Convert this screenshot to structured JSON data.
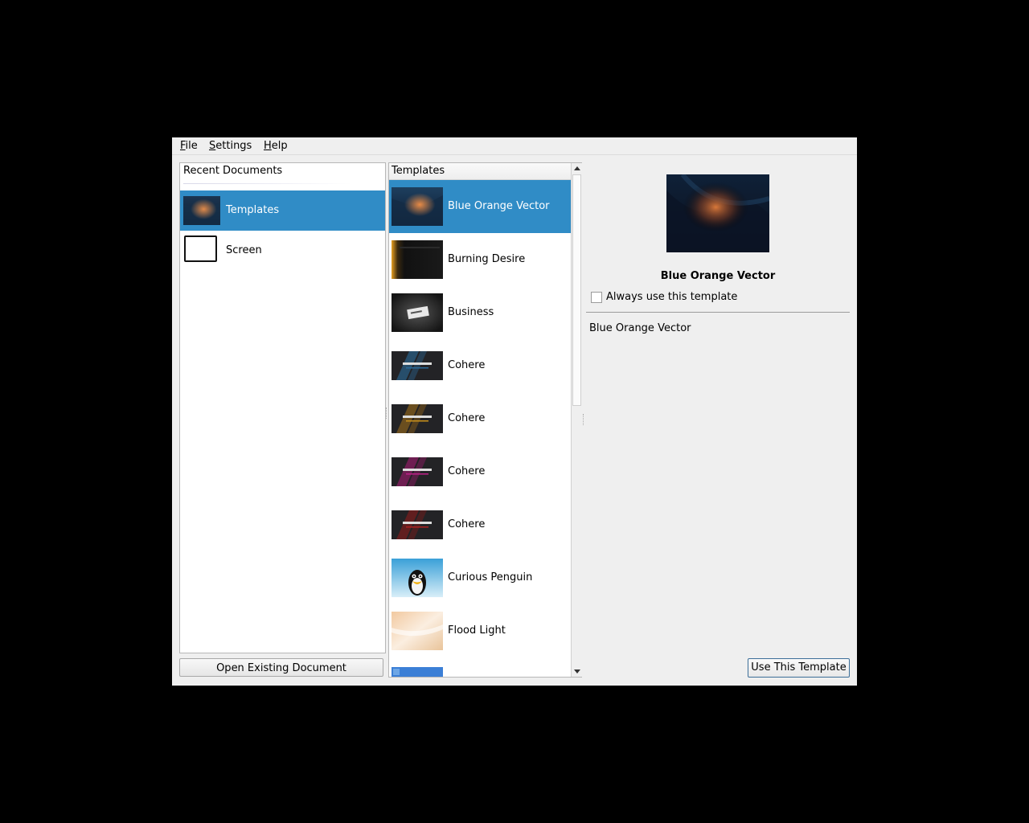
{
  "menu": {
    "file": {
      "first": "F",
      "rest": "ile"
    },
    "settings": {
      "first": "S",
      "rest": "ettings"
    },
    "help": {
      "first": "H",
      "rest": "elp"
    }
  },
  "recent": {
    "title": "Recent Documents",
    "items": [
      {
        "label": "Templates",
        "selected": true
      },
      {
        "label": "Screen",
        "selected": false
      }
    ],
    "open_button": "Open Existing Document"
  },
  "templates": {
    "header": "Templates",
    "items": [
      {
        "label": "Blue Orange Vector",
        "selected": true,
        "thumb": "blue-orange"
      },
      {
        "label": "Burning Desire",
        "thumb": "burning"
      },
      {
        "label": "Business",
        "thumb": "business"
      },
      {
        "label": "Cohere",
        "thumb": "cohere-blue",
        "accent": "#2a6a9a"
      },
      {
        "label": "Cohere",
        "thumb": "cohere-orange",
        "accent": "#9a6a1a"
      },
      {
        "label": "Cohere",
        "thumb": "cohere-magenta",
        "accent": "#a01a70"
      },
      {
        "label": "Cohere",
        "thumb": "cohere-red",
        "accent": "#8a1a1a"
      },
      {
        "label": "Curious Penguin",
        "thumb": "penguin"
      },
      {
        "label": "Flood Light",
        "thumb": "floodlight"
      }
    ]
  },
  "detail": {
    "title": "Blue Orange Vector",
    "always_use_label": "Always use this template",
    "description": "Blue Orange Vector",
    "use_button": "Use This Template"
  },
  "colors": {
    "selection": "#308cc6",
    "window_bg": "#efefef"
  }
}
